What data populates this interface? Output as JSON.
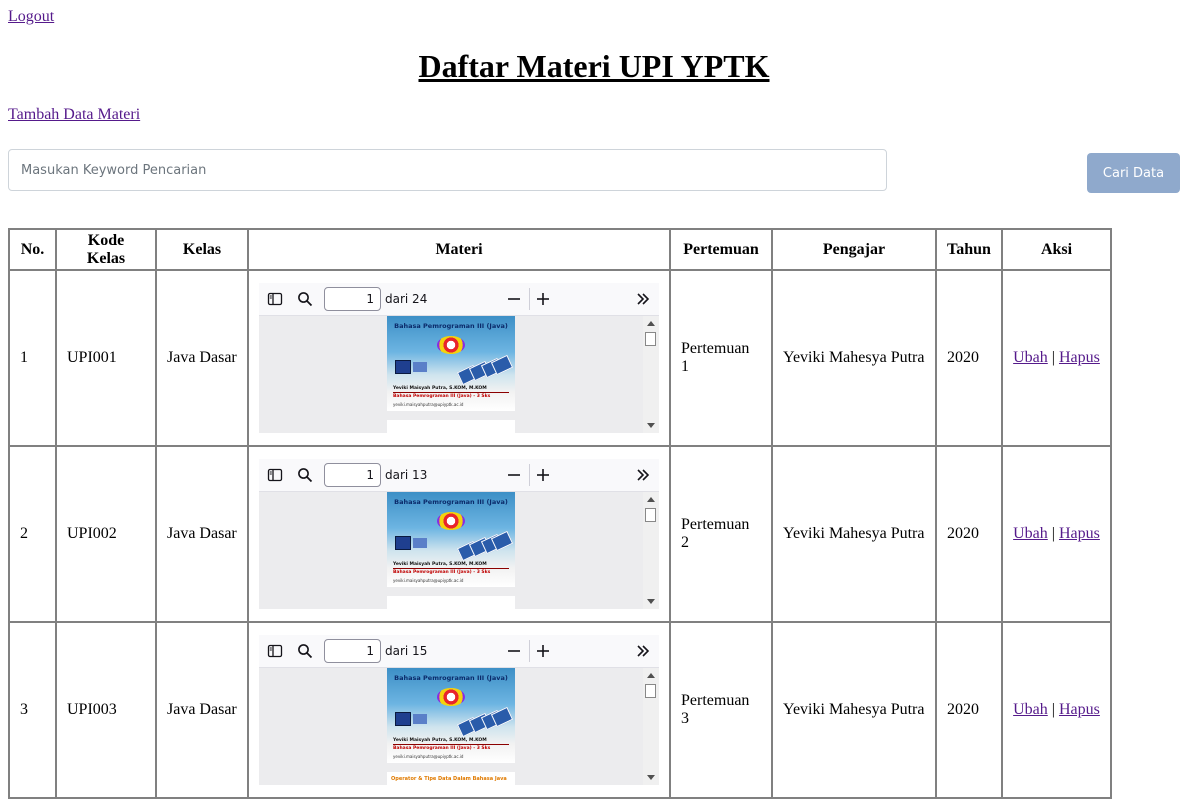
{
  "header": {
    "logout_label": "Logout",
    "title": "Daftar Materi UPI YPTK",
    "add_label": "Tambah Data Materi"
  },
  "search": {
    "placeholder": "Masukan Keyword Pencarian",
    "button_label": "Cari Data"
  },
  "table": {
    "headers": [
      "No.",
      "Kode Kelas",
      "Kelas",
      "Materi",
      "Pertemuan",
      "Pengajar",
      "Tahun",
      "Aksi"
    ],
    "rows": [
      {
        "no": "1",
        "kode": "UPI001",
        "kelas": "Java Dasar",
        "pertemuan": "Pertemuan 1",
        "pengajar": "Yeviki Mahesya Putra",
        "tahun": "2020",
        "edit_label": "Ubah",
        "separator": "|",
        "delete_label": "Hapus",
        "pdf": {
          "page": "1",
          "total": "dari 24",
          "slide_title": "Bahasa Pemrograman III (Java)",
          "slide_author": "Yeviki Maisyah Putra, S.KOM, M.KOM",
          "slide_subtitle": "Bahasa Pemrograman III (Java) - 3 Sks",
          "slide_email": "yeviki.maisyahputra@upiyptk.ac.id",
          "next_page_text": ""
        }
      },
      {
        "no": "2",
        "kode": "UPI002",
        "kelas": "Java Dasar",
        "pertemuan": "Pertemuan 2",
        "pengajar": "Yeviki Mahesya Putra",
        "tahun": "2020",
        "edit_label": "Ubah",
        "separator": "|",
        "delete_label": "Hapus",
        "pdf": {
          "page": "1",
          "total": "dari 13",
          "slide_title": "Bahasa Pemrograman III (Java)",
          "slide_author": "Yeviki Maisyah Putra, S.KOM, M.KOM",
          "slide_subtitle": "Bahasa Pemrograman III (Java) - 3 Sks",
          "slide_email": "yeviki.maisyahputra@upiyptk.ac.id",
          "next_page_text": ""
        }
      },
      {
        "no": "3",
        "kode": "UPI003",
        "kelas": "Java Dasar",
        "pertemuan": "Pertemuan 3",
        "pengajar": "Yeviki Mahesya Putra",
        "tahun": "2020",
        "edit_label": "Ubah",
        "separator": "|",
        "delete_label": "Hapus",
        "pdf": {
          "page": "1",
          "total": "dari 15",
          "slide_title": "Bahasa Pemrograman III (Java)",
          "slide_author": "Yeviki Maisyah Putra, S.KOM, M.KOM",
          "slide_subtitle": "Bahasa Pemrograman III (Java) - 3 Sks",
          "slide_email": "yeviki.maisyahputra@upiyptk.ac.id",
          "next_page_text": "Operator & Tipe Data Dalam Bahasa Java"
        }
      }
    ]
  },
  "colors": {
    "link": "#551a8b",
    "search_button_bg": "#8fa9cc",
    "table_border": "#808080"
  },
  "icons": [
    "sidebar-toggle-icon",
    "search-icon",
    "zoom-out-icon",
    "zoom-in-icon",
    "more-tools-icon"
  ]
}
